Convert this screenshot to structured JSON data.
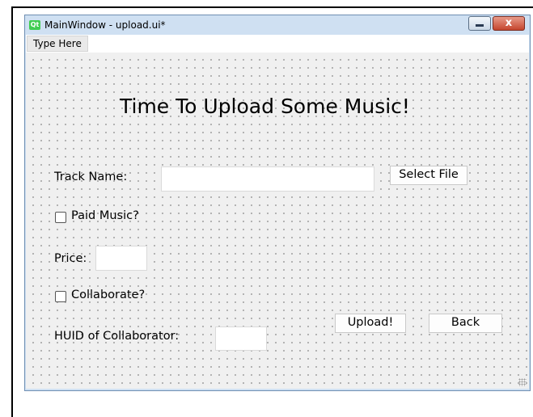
{
  "window": {
    "app_logo_text": "Qt",
    "title": "MainWindow - upload.ui*",
    "close_glyph": "x"
  },
  "menubar": {
    "item_label": "Type Here"
  },
  "form": {
    "heading": "Time To Upload Some Music!",
    "track_name_label": "Track Name:",
    "track_name_value": "",
    "select_file_label": "Select File",
    "paid_music_label": "Paid Music?",
    "paid_music_checked": false,
    "price_label": "Price:",
    "price_value": "",
    "collaborate_label": "Collaborate?",
    "collaborate_checked": false,
    "huid_label": "HUID of Collaborator:",
    "huid_value": "",
    "upload_label": "Upload!",
    "back_label": "Back"
  }
}
